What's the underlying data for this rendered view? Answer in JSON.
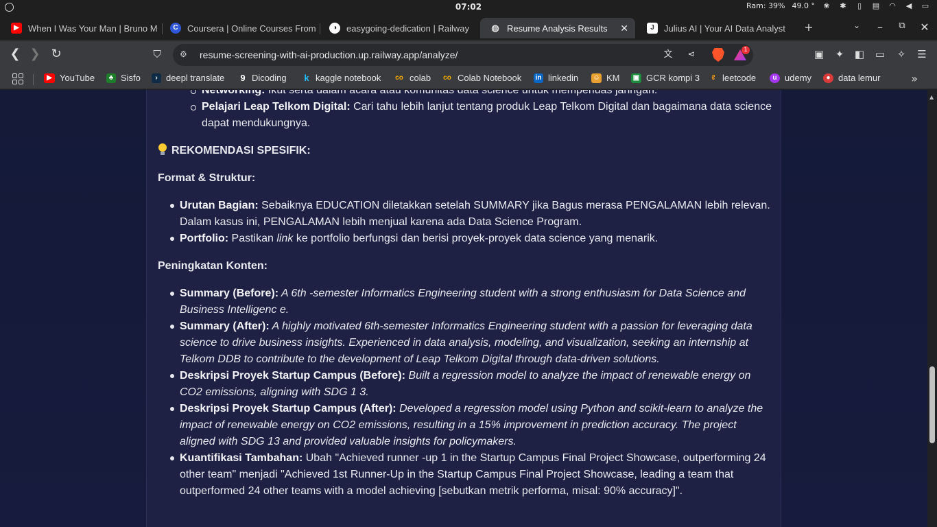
{
  "system": {
    "clock": "07:02",
    "ram": "Ram: 39%",
    "temp": "49.0 °"
  },
  "tabs": [
    {
      "title": "When I Was Your Man | Bruno M",
      "icon": "youtube-icon",
      "color": "#ff0000"
    },
    {
      "title": "Coursera | Online Courses From",
      "icon": "coursera-icon",
      "color": "#2f57d6"
    },
    {
      "title": "easygoing-dedication | Railway",
      "icon": "railway-icon",
      "color": "#ffffff"
    },
    {
      "title": "Resume Analysis Results",
      "icon": "chart-icon",
      "color": "#dddddd",
      "active": true
    },
    {
      "title": "Julius AI | Your AI Data Analyst",
      "icon": "julius-icon",
      "color": "#ffffff"
    }
  ],
  "address": {
    "url": "resume-screening-with-ai-production.up.railway.app/analyze/",
    "notification_count": "1"
  },
  "bookmarks": [
    {
      "label": "YouTube",
      "icon": "youtube-icon",
      "color": "#ff0000"
    },
    {
      "label": "Sisfo",
      "icon": "sisfo-icon",
      "color": "#1e7d2a"
    },
    {
      "label": "deepl translate",
      "icon": "deepl-icon",
      "color": "#0f2b46"
    },
    {
      "label": "Dicoding",
      "icon": "dicoding-icon",
      "color": "#2d3e50"
    },
    {
      "label": "kaggle notebook",
      "icon": "kaggle-icon",
      "color": "#20beff"
    },
    {
      "label": "colab",
      "icon": "colab-icon",
      "color": "#f9ab00"
    },
    {
      "label": "Colab Notebook",
      "icon": "colab-icon",
      "color": "#f9ab00"
    },
    {
      "label": "linkedin",
      "icon": "linkedin-icon",
      "color": "#0a66c2"
    },
    {
      "label": "KM",
      "icon": "km-icon",
      "color": "#e8a030"
    },
    {
      "label": "GCR kompi 3",
      "icon": "classroom-icon",
      "color": "#1e8e3e"
    },
    {
      "label": "leetcode",
      "icon": "leetcode-icon",
      "color": "#ffa116"
    },
    {
      "label": "udemy",
      "icon": "udemy-icon",
      "color": "#a435f0"
    },
    {
      "label": "data lemur",
      "icon": "datalemur-icon",
      "color": "#d93b3b"
    }
  ],
  "content": {
    "top_list": [
      {
        "bold": "Networking:",
        "text": " Ikut serta dalam acara atau komunitas data science untuk memperluas jaringan."
      },
      {
        "bold": "Pelajari Leap Telkom Digital:",
        "text": " Cari tahu lebih lanjut tentang produk Leap Telkom Digital dan bagaimana data science dapat mendukungnya."
      }
    ],
    "rekomendasi_heading": "REKOMENDASI SPESIFIK:",
    "format_heading": "Format & Struktur:",
    "format_list": [
      {
        "bold": "Urutan Bagian:",
        "text": " Sebaiknya EDUCATION diletakkan setelah SUMMARY jika Bagus merasa PENGALAMAN lebih relevan. Dalam kasus ini, PENGALAMAN lebih menjual karena ada Data Science Program."
      },
      {
        "bold": "Portfolio:",
        "text_before": " Pastikan ",
        "italic": "link",
        "text_after": " ke portfolio berfungsi dan berisi proyek-proyek data science yang menarik."
      }
    ],
    "konten_heading": "Peningkatan Konten:",
    "konten_list": [
      {
        "bold": "Summary (Before):",
        "italic": " A 6th -semester Informatics Engineering student with a strong enthusiasm for Data Science and Business Intelligenc e."
      },
      {
        "bold": "Summary (After):",
        "italic": " A highly motivated 6th-semester Informatics Engineering student with a passion for leveraging data science to drive business insights. Experienced in data analysis, modeling, and visualization, seeking an internship at Telkom DDB to contribute to the development of Leap Telkom Digital through data-driven solutions."
      },
      {
        "bold": "Deskripsi Proyek Startup Campus (Before):",
        "italic": " Built a regression model to analyze the impact of renewable energy on CO2 emissions, aligning with SDG 1 3."
      },
      {
        "bold": "Deskripsi Proyek Startup Campus (After):",
        "italic": " Developed a regression model using Python and scikit-learn to analyze the impact of renewable energy on CO2 emissions, resulting in a 15% improvement in prediction accuracy. The project aligned with SDG 13 and provided valuable insights for policymakers."
      },
      {
        "bold": "Kuantifikasi Tambahan:",
        "text": " Ubah \"Achieved runner -up 1 in the Startup Campus Final Project Showcase, outperforming 24 other team\" menjadi \"Achieved 1st Runner-Up in the Startup Campus Final Project Showcase, leading a team that outperformed 24 other teams with a model achieving [sebutkan metrik performa, misal: 90% accuracy]\"."
      }
    ]
  }
}
